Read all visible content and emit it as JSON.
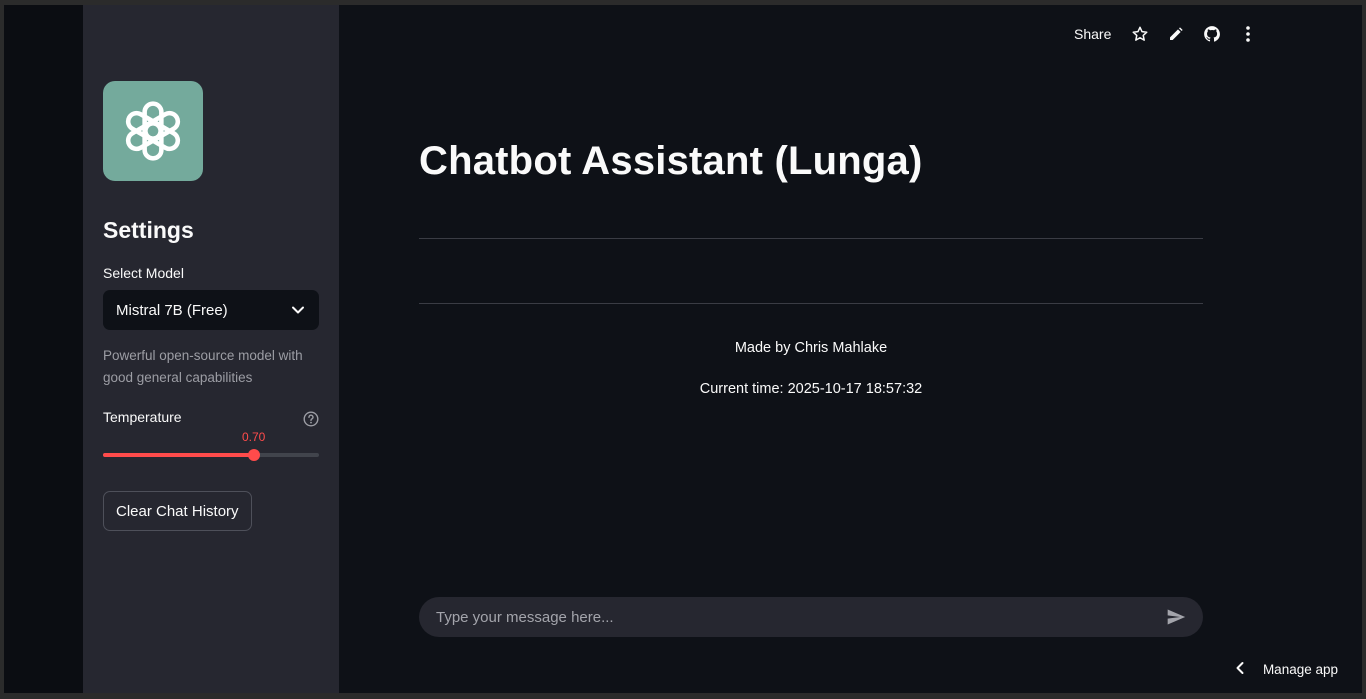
{
  "sidebar": {
    "logo_icon": "openai-logo-icon",
    "title": "Settings",
    "model_label": "Select Model",
    "model_selected": "Mistral 7B (Free)",
    "model_description": "Powerful open-source model with good general capabilities",
    "temperature_label": "Temperature",
    "temperature_value": "0.70",
    "temperature_fraction": 0.7,
    "clear_button": "Clear Chat History"
  },
  "toolbar": {
    "share_label": "Share",
    "icons": [
      "star-icon",
      "edit-icon",
      "github-icon",
      "more-vertical-icon"
    ]
  },
  "main": {
    "title": "Chatbot Assistant (Lunga)",
    "made_by": "Made by Chris Mahlake",
    "current_time": "Current time: 2025-10-17 18:57:32"
  },
  "chat": {
    "placeholder": "Type your message here..."
  },
  "footer": {
    "manage_label": "Manage app"
  },
  "colors": {
    "accent": "#ff4b4b",
    "sidebar_bg": "#262730",
    "main_bg": "#0e1117",
    "logo_bg": "#74aa9c"
  }
}
